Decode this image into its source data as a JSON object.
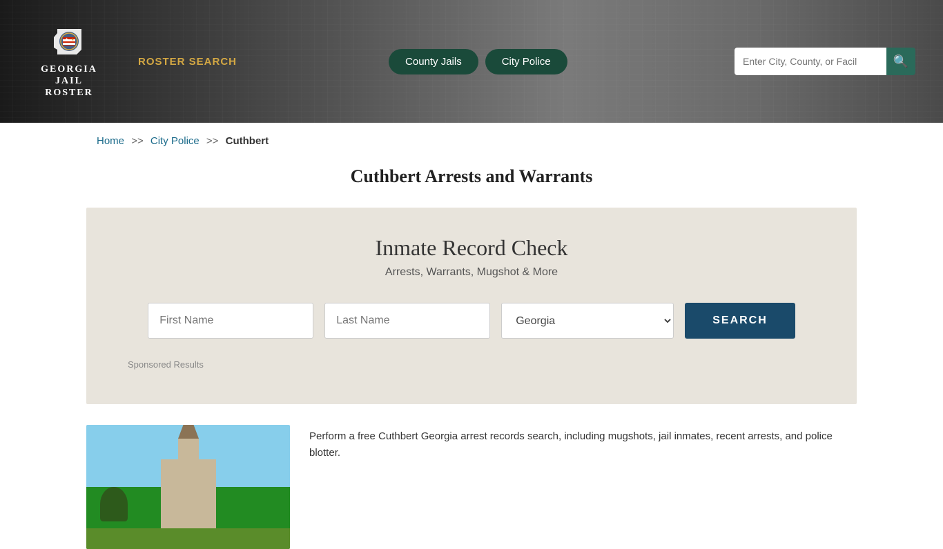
{
  "header": {
    "logo": {
      "georgia": "GEORGIA",
      "jail": "JAIL",
      "roster": "ROSTER"
    },
    "nav": {
      "roster_search": "ROSTER SEARCH",
      "county_jails": "County Jails",
      "city_police": "City Police"
    },
    "search": {
      "placeholder": "Enter City, County, or Facil"
    }
  },
  "breadcrumb": {
    "home": "Home",
    "separator1": ">>",
    "city_police": "City Police",
    "separator2": ">>",
    "current": "Cuthbert"
  },
  "page": {
    "title": "Cuthbert Arrests and Warrants"
  },
  "inmate_section": {
    "title": "Inmate Record Check",
    "subtitle": "Arrests, Warrants, Mugshot & More",
    "first_name_placeholder": "First Name",
    "last_name_placeholder": "Last Name",
    "state_default": "Georgia",
    "search_button": "SEARCH",
    "sponsored_label": "Sponsored Results"
  },
  "bottom": {
    "description": "Perform a free Cuthbert Georgia arrest records search, including mugshots, jail inmates, recent arrests, and police blotter."
  }
}
